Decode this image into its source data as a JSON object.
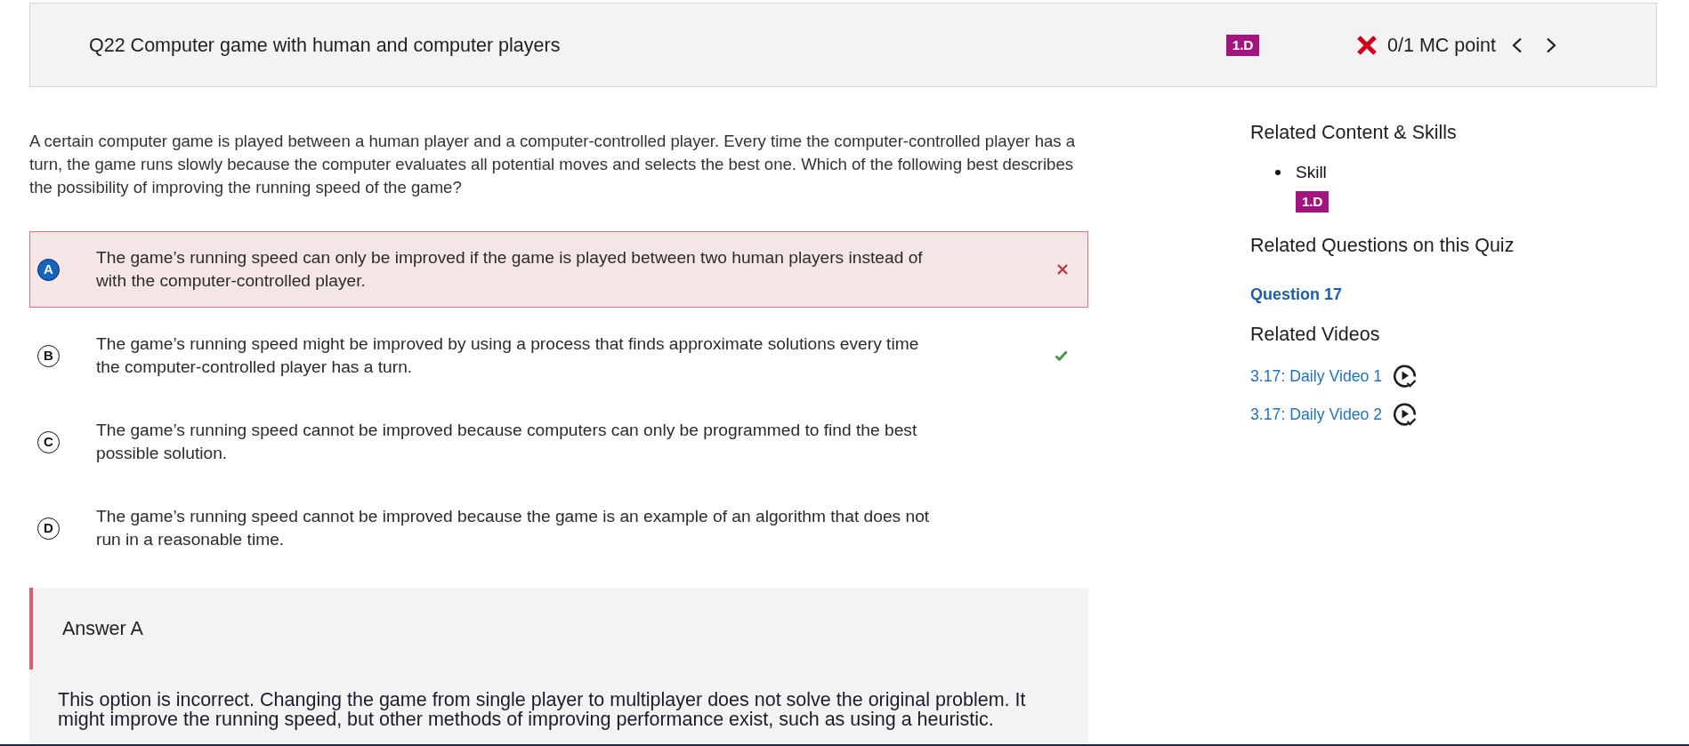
{
  "header": {
    "title": "Q22 Computer game with human and computer players",
    "skill_badge": "1.D",
    "score": {
      "correct": false,
      "text": "0/1 MC point"
    }
  },
  "question": {
    "text": "A certain computer game is played between a human player and a computer-controlled player. Every time the computer-controlled player has a turn, the game runs slowly because the computer evaluates all potential moves and selects the best one. Which of the following best describes the possibility of improving the running speed of the game?"
  },
  "options": [
    {
      "letter": "A",
      "text": "The game’s running speed can only be improved if the game is played between two human players instead of with the computer-controlled player.",
      "selected": true,
      "correct": false
    },
    {
      "letter": "B",
      "text": "The game’s running speed might be improved by using a process that finds approximate solutions every time the computer-controlled player has a turn.",
      "selected": false,
      "correct": true
    },
    {
      "letter": "C",
      "text": "The game’s running speed cannot be improved because computers can only be programmed to find the best possible solution.",
      "selected": false,
      "correct": false
    },
    {
      "letter": "D",
      "text": "The game’s running speed cannot be improved because the game is an example of an algorithm that does not run in a reasonable time.",
      "selected": false,
      "correct": false
    }
  ],
  "explanation": {
    "title": "Answer A",
    "correct": false,
    "text": "This option is incorrect. Changing the game from single player to multiplayer does not solve the original problem. It might improve the running speed, but other methods of improving performance exist, such as using a heuristic."
  },
  "sidebar": {
    "sections": [
      {
        "kind": "skills",
        "title": "Related Content & Skills",
        "items": [
          {
            "label": "Skill",
            "badge": "1.D"
          }
        ]
      },
      {
        "kind": "questions",
        "title": "Related Questions on this Quiz",
        "items": [
          {
            "label": "Question 17"
          }
        ]
      },
      {
        "kind": "videos",
        "title": "Related Videos",
        "items": [
          {
            "label": "3.17: Daily Video 1"
          },
          {
            "label": "3.17: Daily Video 2"
          }
        ]
      }
    ]
  }
}
